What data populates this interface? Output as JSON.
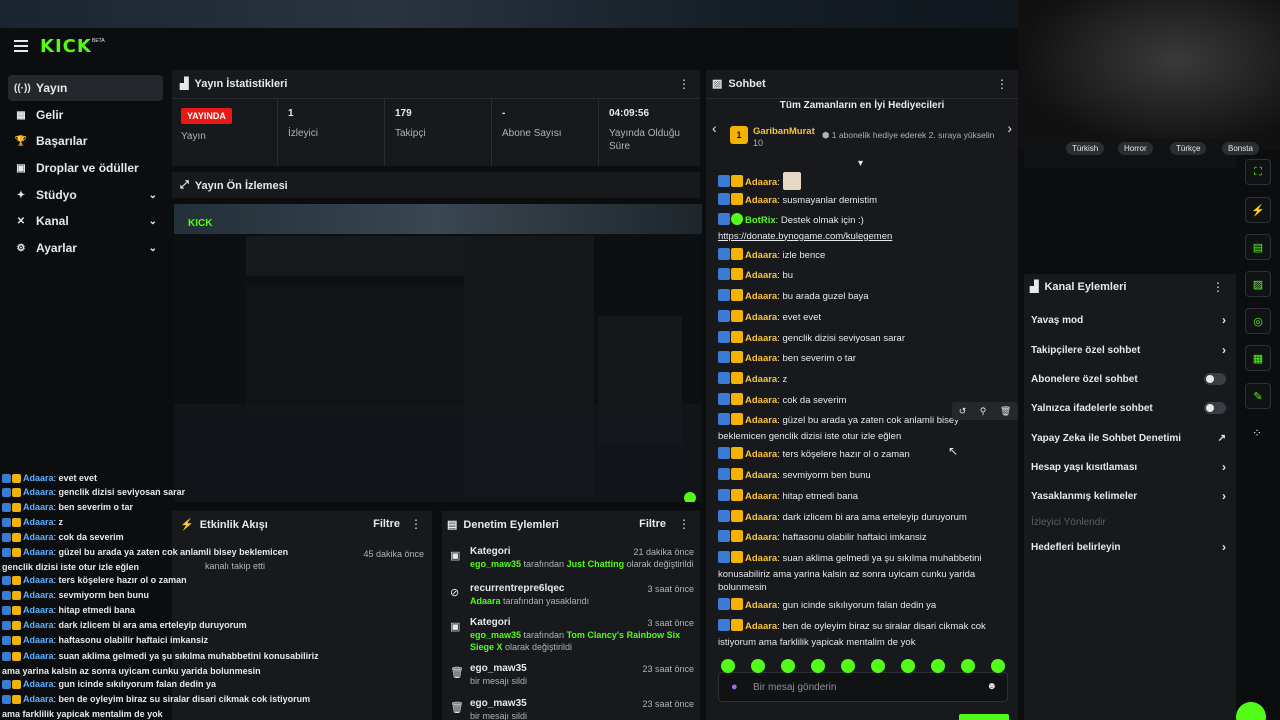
{
  "app": {
    "logo": "KICK",
    "beta": "BETA"
  },
  "sidebar": {
    "items": [
      {
        "label": "Yayın",
        "icon": "broadcast-icon",
        "glyph": "((·))"
      },
      {
        "label": "Gelir",
        "icon": "revenue-icon",
        "glyph": "▦"
      },
      {
        "label": "Başarılar",
        "icon": "trophy-icon",
        "glyph": "🏆"
      },
      {
        "label": "Droplar ve ödüller",
        "icon": "gift-icon",
        "glyph": "▣"
      },
      {
        "label": "Stüdyo",
        "icon": "studio-icon",
        "glyph": "✦"
      },
      {
        "label": "Kanal",
        "icon": "channel-icon",
        "glyph": "✕"
      },
      {
        "label": "Ayarlar",
        "icon": "settings-icon",
        "glyph": "⚙"
      }
    ]
  },
  "stats": {
    "title": "Yayın İstatistikleri",
    "live_badge": "YAYINDA",
    "live_label": "Yayın",
    "viewers_value": "1",
    "viewers_label": "İzleyici",
    "followers_value": "179",
    "followers_label": "Takipçi",
    "subs_value": "-",
    "subs_label": "Abone Sayısı",
    "time_value": "04:09:56",
    "time_label": "Yayında Olduğu Süre"
  },
  "preview": {
    "title": "Yayın Ön İzlemesi"
  },
  "activity": {
    "title": "Etkinlik Akışı",
    "filter": "Filtre",
    "time": "45 dakika önce",
    "text": "kanalı takip etti"
  },
  "moderation": {
    "title": "Denetim Eylemleri",
    "filter": "Filtre",
    "items": [
      {
        "title": "Kategori",
        "time": "21 dakika önce",
        "user": "ego_maw35",
        "mid": " tarafından ",
        "target": "Just Chatting",
        "rest": " olarak değiştirildi"
      },
      {
        "title": "recurrentrepre6lqec",
        "time": "3 saat önce",
        "user": "Adaara",
        "mid": " tarafından yasaklandı",
        "target": "",
        "rest": ""
      },
      {
        "title": "Kategori",
        "time": "3 saat önce",
        "user": "ego_maw35",
        "mid": " tarafından ",
        "target": "Tom Clancy's Rainbow Six Siege X",
        "rest": " olarak değiştirildi"
      },
      {
        "title": "ego_maw35",
        "time": "23 saat önce",
        "user": "",
        "mid": "bir mesajı sildi",
        "target": "",
        "rest": ""
      },
      {
        "title": "ego_maw35",
        "time": "23 saat önce",
        "user": "",
        "mid": "bir mesajı sildi",
        "target": "",
        "rest": ""
      }
    ]
  },
  "chat": {
    "title": "Sohbet",
    "leaderboard_title": "Tüm Zamanların en İyi Hediyecileri",
    "top_gifter": "GaribanMurat",
    "top_gifter_count": "10",
    "rank": "1",
    "gift_note": "1 abonelik hediye ederek 2. sıraya yükselin",
    "input_placeholder": "Bir mesaj gönderin",
    "messages": [
      {
        "user": "Adaara",
        "text": ""
      },
      {
        "user": "Adaara",
        "text": "susmayanlar demistim"
      },
      {
        "user": "BotRix",
        "text": "Destek olmak için :)",
        "link": "https://donate.bynogame.com/kulegemen"
      },
      {
        "user": "Adaara",
        "text": "izle bence"
      },
      {
        "user": "Adaara",
        "text": "bu"
      },
      {
        "user": "Adaara",
        "text": "bu arada guzel baya"
      },
      {
        "user": "Adaara",
        "text": "evet evet"
      },
      {
        "user": "Adaara",
        "text": "genclik dizisi seviyosan sarar"
      },
      {
        "user": "Adaara",
        "text": "ben severim o tar"
      },
      {
        "user": "Adaara",
        "text": "z"
      },
      {
        "user": "Adaara",
        "text": "cok da severim"
      },
      {
        "user": "Adaara",
        "text": "güzel bu arada ya zaten cok anlamli bisey beklemicen genclik dizisi iste otur izle eğlen"
      },
      {
        "user": "Adaara",
        "text": "ters köşelere hazır ol o zaman"
      },
      {
        "user": "Adaara",
        "text": "sevmiyorm ben bunu"
      },
      {
        "user": "Adaara",
        "text": "hitap etmedi bana"
      },
      {
        "user": "Adaara",
        "text": "dark izlicem bi ara ama erteleyip duruyorum"
      },
      {
        "user": "Adaara",
        "text": "haftasonu olabilir haftaici imkansiz"
      },
      {
        "user": "Adaara",
        "text": "suan aklima gelmedi ya şu sıkılma muhabbetini konusabiliriz ama yarina kalsin az sonra uyicam cunku yarida bolunmesin"
      },
      {
        "user": "Adaara",
        "text": "gun icinde sıkılıyorum falan dedin ya"
      },
      {
        "user": "Adaara",
        "text": "ben de oyleyim biraz su siralar disari cikmak cok istiyorum ama farklilik yapicak mentalim de yok"
      }
    ]
  },
  "actions": {
    "title": "Kanal Eylemleri",
    "items": [
      {
        "label": "Yavaş mod",
        "kind": "chevron"
      },
      {
        "label": "Takipçilere özel sohbet",
        "kind": "chevron"
      },
      {
        "label": "Abonelere özel sohbet",
        "kind": "toggle"
      },
      {
        "label": "Yalnızca ifadelerle sohbet",
        "kind": "toggle"
      },
      {
        "label": "Yapay Zeka ile Sohbet Denetimi",
        "kind": "external"
      },
      {
        "label": "Hesap yaşı kısıtlaması",
        "kind": "chevron"
      },
      {
        "label": "Yasaklanmış kelimeler",
        "kind": "chevron"
      },
      {
        "label": "İzleyici Yönlendir",
        "kind": "disabled"
      },
      {
        "label": "Hedefleri belirleyin",
        "kind": "chevron"
      }
    ],
    "tags": [
      "Türkish",
      "Horror",
      "Türkçe",
      "Bonsta"
    ]
  },
  "overlay": {
    "lines": [
      {
        "user": "Adaara",
        "text": "evet evet"
      },
      {
        "user": "Adaara",
        "text": "genclik dizisi seviyosan sarar"
      },
      {
        "user": "Adaara",
        "text": "ben severim o tar"
      },
      {
        "user": "Adaara",
        "text": "z"
      },
      {
        "user": "Adaara",
        "text": "cok da severim"
      },
      {
        "user": "Adaara",
        "text": "güzel bu arada ya zaten cok anlamli bisey beklemicen genclik dizisi iste otur izle eğlen"
      },
      {
        "user": "Adaara",
        "text": "ters köşelere hazır ol o zaman"
      },
      {
        "user": "Adaara",
        "text": "sevmiyorm ben bunu"
      },
      {
        "user": "Adaara",
        "text": "hitap etmedi bana"
      },
      {
        "user": "Adaara",
        "text": "dark izlicem bi ara ama erteleyip duruyorum"
      },
      {
        "user": "Adaara",
        "text": "haftasonu olabilir haftaici imkansiz"
      },
      {
        "user": "Adaara",
        "text": "suan aklima gelmedi ya şu sıkılma muhabbetini konusabiliriz ama yarina kalsin az sonra uyicam cunku yarida bolunmesin"
      },
      {
        "user": "Adaara",
        "text": "gun icinde sıkılıyorum falan dedin ya"
      },
      {
        "user": "Adaara",
        "text": "ben de oyleyim biraz su siralar disari cikmak cok istiyorum ama farklilik yapicak mentalim de yok"
      }
    ]
  }
}
